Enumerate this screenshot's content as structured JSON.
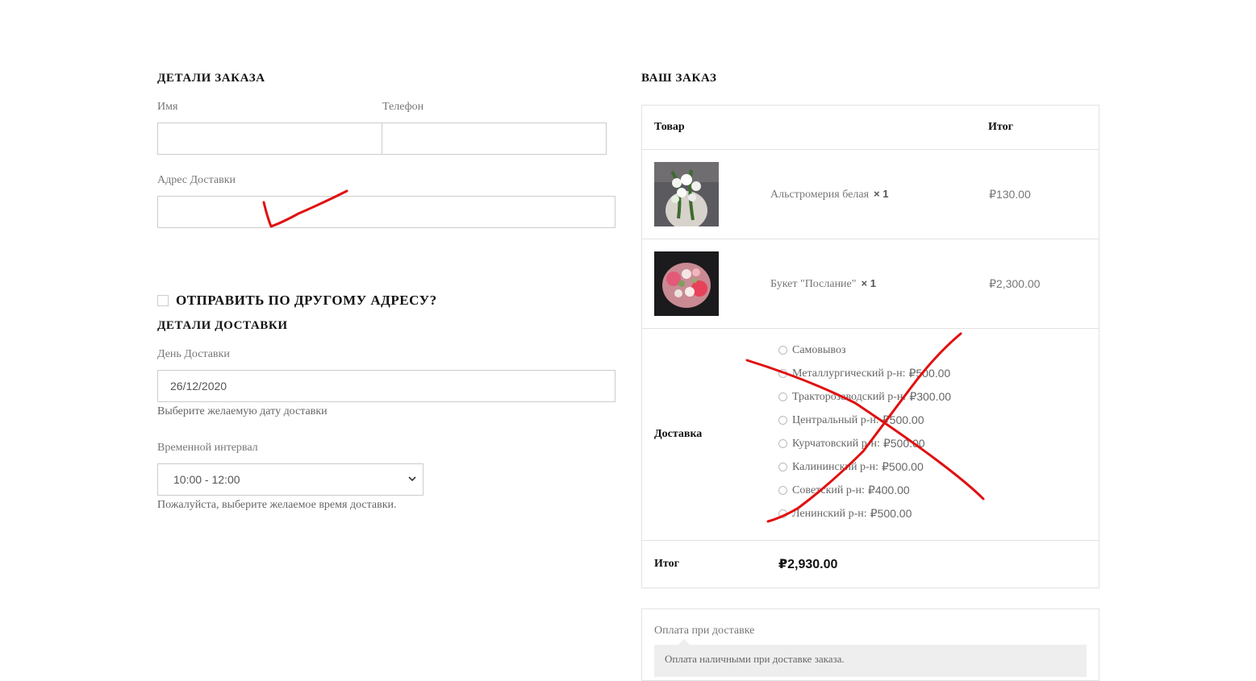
{
  "billing": {
    "title": "ДЕТАЛИ ЗАКАЗА",
    "name_label": "Имя",
    "name_value": "",
    "phone_label": "Телефон",
    "phone_value": "",
    "address_label": "Адрес Доставки",
    "address_value": ""
  },
  "ship_to_different": {
    "label": "ОТПРАВИТЬ ПО ДРУГОМУ АДРЕСУ?",
    "checked": false
  },
  "delivery": {
    "title": "ДЕТАЛИ ДОСТАВКИ",
    "day_label": "День Доставки",
    "day_value": "26/12/2020",
    "day_hint": "Выберите желаемую дату доставки",
    "interval_label": "Временной интервал",
    "interval_value": "10:00 - 12:00",
    "interval_hint": "Пожалуйста, выберите желаемое время доставки."
  },
  "order": {
    "title": "ВАШ ЗАКАЗ",
    "col_product": "Товар",
    "col_total": "Итог",
    "items": [
      {
        "name": "Альстромерия белая",
        "qty": "× 1",
        "price": "₽130.00"
      },
      {
        "name": "Букет \"Послание\"",
        "qty": "× 1",
        "price": "₽2,300.00"
      }
    ],
    "shipping_label": "Доставка",
    "shipping_options": [
      {
        "name": "Самовывоз",
        "price": ""
      },
      {
        "name": "Металлургический р-н:",
        "price": "₽500.00"
      },
      {
        "name": "Тракторозаводский р-н:",
        "price": "₽300.00"
      },
      {
        "name": "Центральный р-н:",
        "price": "₽500.00"
      },
      {
        "name": "Курчатовский р-н:",
        "price": "₽500.00"
      },
      {
        "name": "Калининский р-н:",
        "price": "₽500.00"
      },
      {
        "name": "Советский р-н:",
        "price": "₽400.00"
      },
      {
        "name": "Ленинский р-н:",
        "price": "₽500.00"
      }
    ],
    "total_label": "Итог",
    "total_value": "₽2,930.00"
  },
  "payment": {
    "method": "Оплата при доставке",
    "description": "Оплата наличными при доставке заказа."
  },
  "annotations": {
    "checkmark_color": "#e01010",
    "cross_color": "#e01010"
  }
}
